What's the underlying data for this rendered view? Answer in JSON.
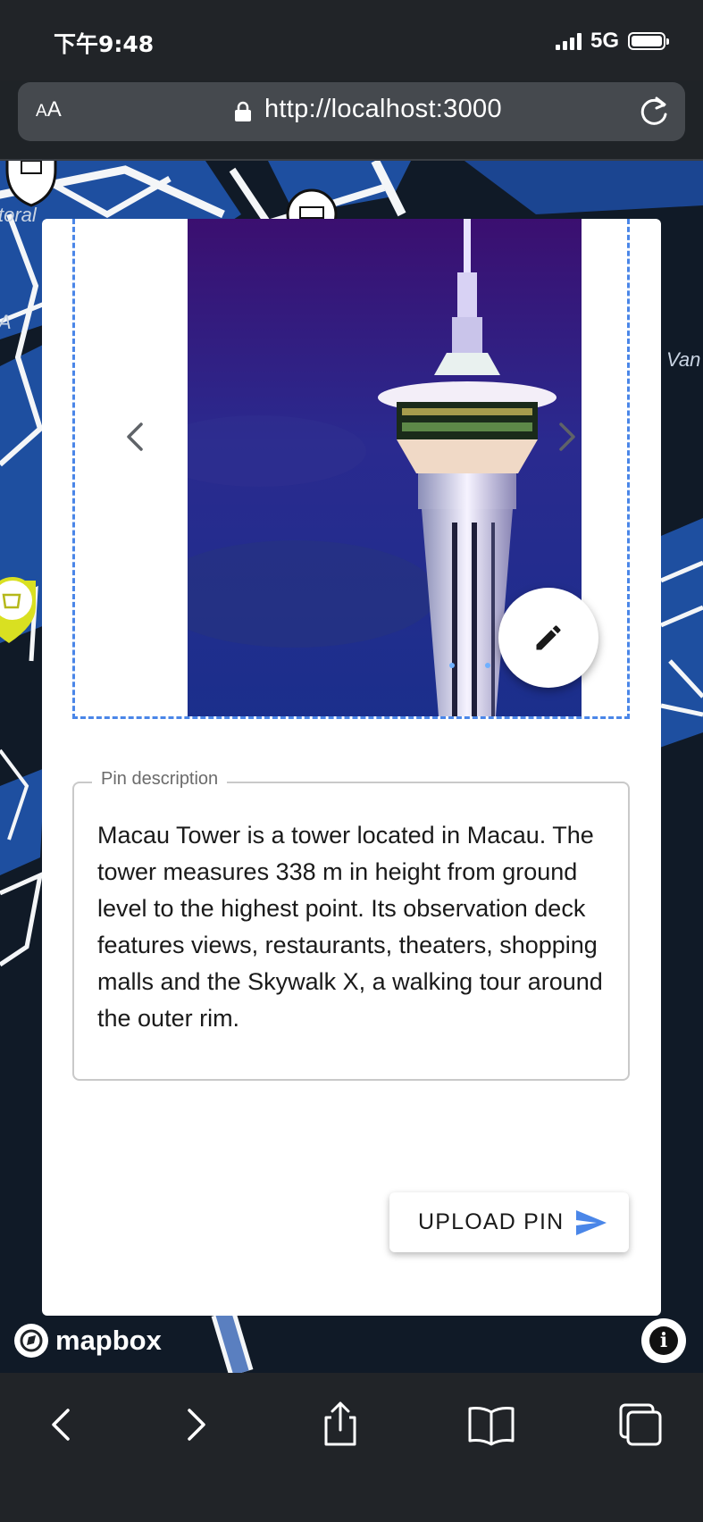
{
  "status_bar": {
    "time": "下午9:48",
    "network": "5G"
  },
  "browser": {
    "aa_label_small": "A",
    "aa_label_large": "A",
    "url": "http://localhost:3000",
    "icons": [
      "lock-icon",
      "reload-icon"
    ]
  },
  "map": {
    "labels": [
      "toral",
      "A",
      "Van"
    ],
    "marker_icons": [
      "church-pin-icon",
      "temple-pin-icon",
      "cafe-pin-icon"
    ]
  },
  "pin_form": {
    "image_alt": "Macau Tower at night",
    "description_label": "Pin description",
    "description_value": "Macau Tower is a tower located in Macau. The tower measures 338 m in height from ground level to the highest point. Its observation deck features views, restaurants, theaters, shopping malls and the Skywalk X, a walking tour around the outer rim.",
    "upload_label": "UPLOAD PIN",
    "accent_color": "#4a86e8"
  },
  "attribution": {
    "brand": "mapbox",
    "info_symbol": "i"
  },
  "toolbar": {
    "icons": [
      "back-icon",
      "forward-icon",
      "share-icon",
      "bookmarks-icon",
      "tabs-icon"
    ]
  }
}
